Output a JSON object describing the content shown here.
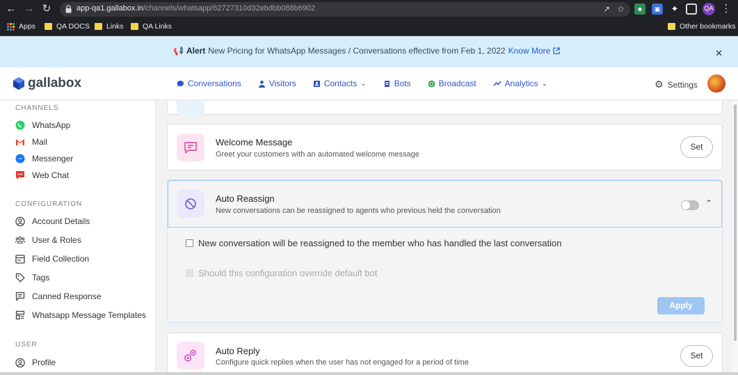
{
  "browser": {
    "url_host": "app-qa1.gallabox.in",
    "url_path": "/channels/whatsapp/62727310d32ebdbb088b6902",
    "profile_initials": "QA",
    "bookmarks": {
      "apps": "Apps",
      "qa_docs": "QA DOCS",
      "links": "Links",
      "qa_links": "QA Links",
      "other": "Other bookmarks"
    }
  },
  "alert": {
    "label": "Alert",
    "message": "New Pricing for WhatsApp Messages / Conversations effective from Feb 1, 2022",
    "link": "Know More"
  },
  "header": {
    "logo": "gallabox",
    "nav": {
      "conversations": "Conversations",
      "visitors": "Visitors",
      "contacts": "Contacts",
      "bots": "Bots",
      "broadcast": "Broadcast",
      "analytics": "Analytics"
    },
    "settings": "Settings"
  },
  "sidebar": {
    "channels_heading": "CHANNELS",
    "channels": {
      "whatsapp": "WhatsApp",
      "mail": "Mail",
      "messenger": "Messenger",
      "webchat": "Web Chat"
    },
    "configuration_heading": "CONFIGURATION",
    "configuration": {
      "account": "Account Details",
      "users": "User & Roles",
      "field": "Field Collection",
      "tags": "Tags",
      "canned": "Canned Response",
      "templates": "Whatsapp Message Templates"
    },
    "user_heading": "USER",
    "user": {
      "profile": "Profile"
    }
  },
  "cards": {
    "welcome": {
      "title": "Welcome Message",
      "description": "Greet your customers with an automated welcome message",
      "button": "Set"
    },
    "reassign": {
      "title": "Auto Reassign",
      "description": "New conversations can be reassigned to agents who previous held the conversation",
      "toggle_on": false,
      "option1": "New conversation will be reassigned to the member who has handled the last conversation",
      "option1_checked": false,
      "option2": "Should this configuration override default bot",
      "option2_disabled": true,
      "apply": "Apply"
    },
    "autoreply": {
      "title": "Auto Reply",
      "description": "Configure quick replies when the user has not engaged for a period of time",
      "button": "Set"
    }
  },
  "colors": {
    "brand": "#2c54c7",
    "alert_bg": "#d6edfb",
    "apply_bg": "#9fc6f2"
  }
}
